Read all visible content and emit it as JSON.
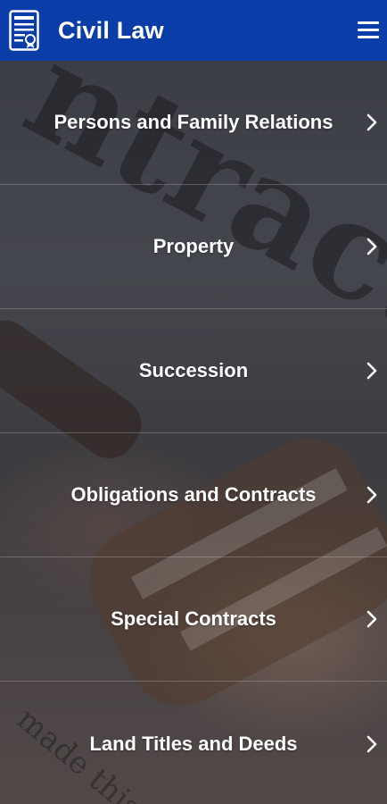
{
  "header": {
    "title": "Civil Law",
    "logo_icon": "legal-document-icon",
    "menu_icon": "hamburger-menu-icon",
    "bar_color": "#0b3da8"
  },
  "topics": [
    {
      "label": "Persons and Family Relations",
      "icon": "chevron-right-icon"
    },
    {
      "label": "Property",
      "icon": "chevron-right-icon"
    },
    {
      "label": "Succession",
      "icon": "chevron-right-icon"
    },
    {
      "label": "Obligations and Contracts",
      "icon": "chevron-right-icon"
    },
    {
      "label": "Special Contracts",
      "icon": "chevron-right-icon"
    },
    {
      "label": "Land Titles and Deeds",
      "icon": "chevron-right-icon"
    }
  ],
  "background": {
    "image": "contract-and-gavel-photo",
    "overlay_color": "#14161e"
  }
}
